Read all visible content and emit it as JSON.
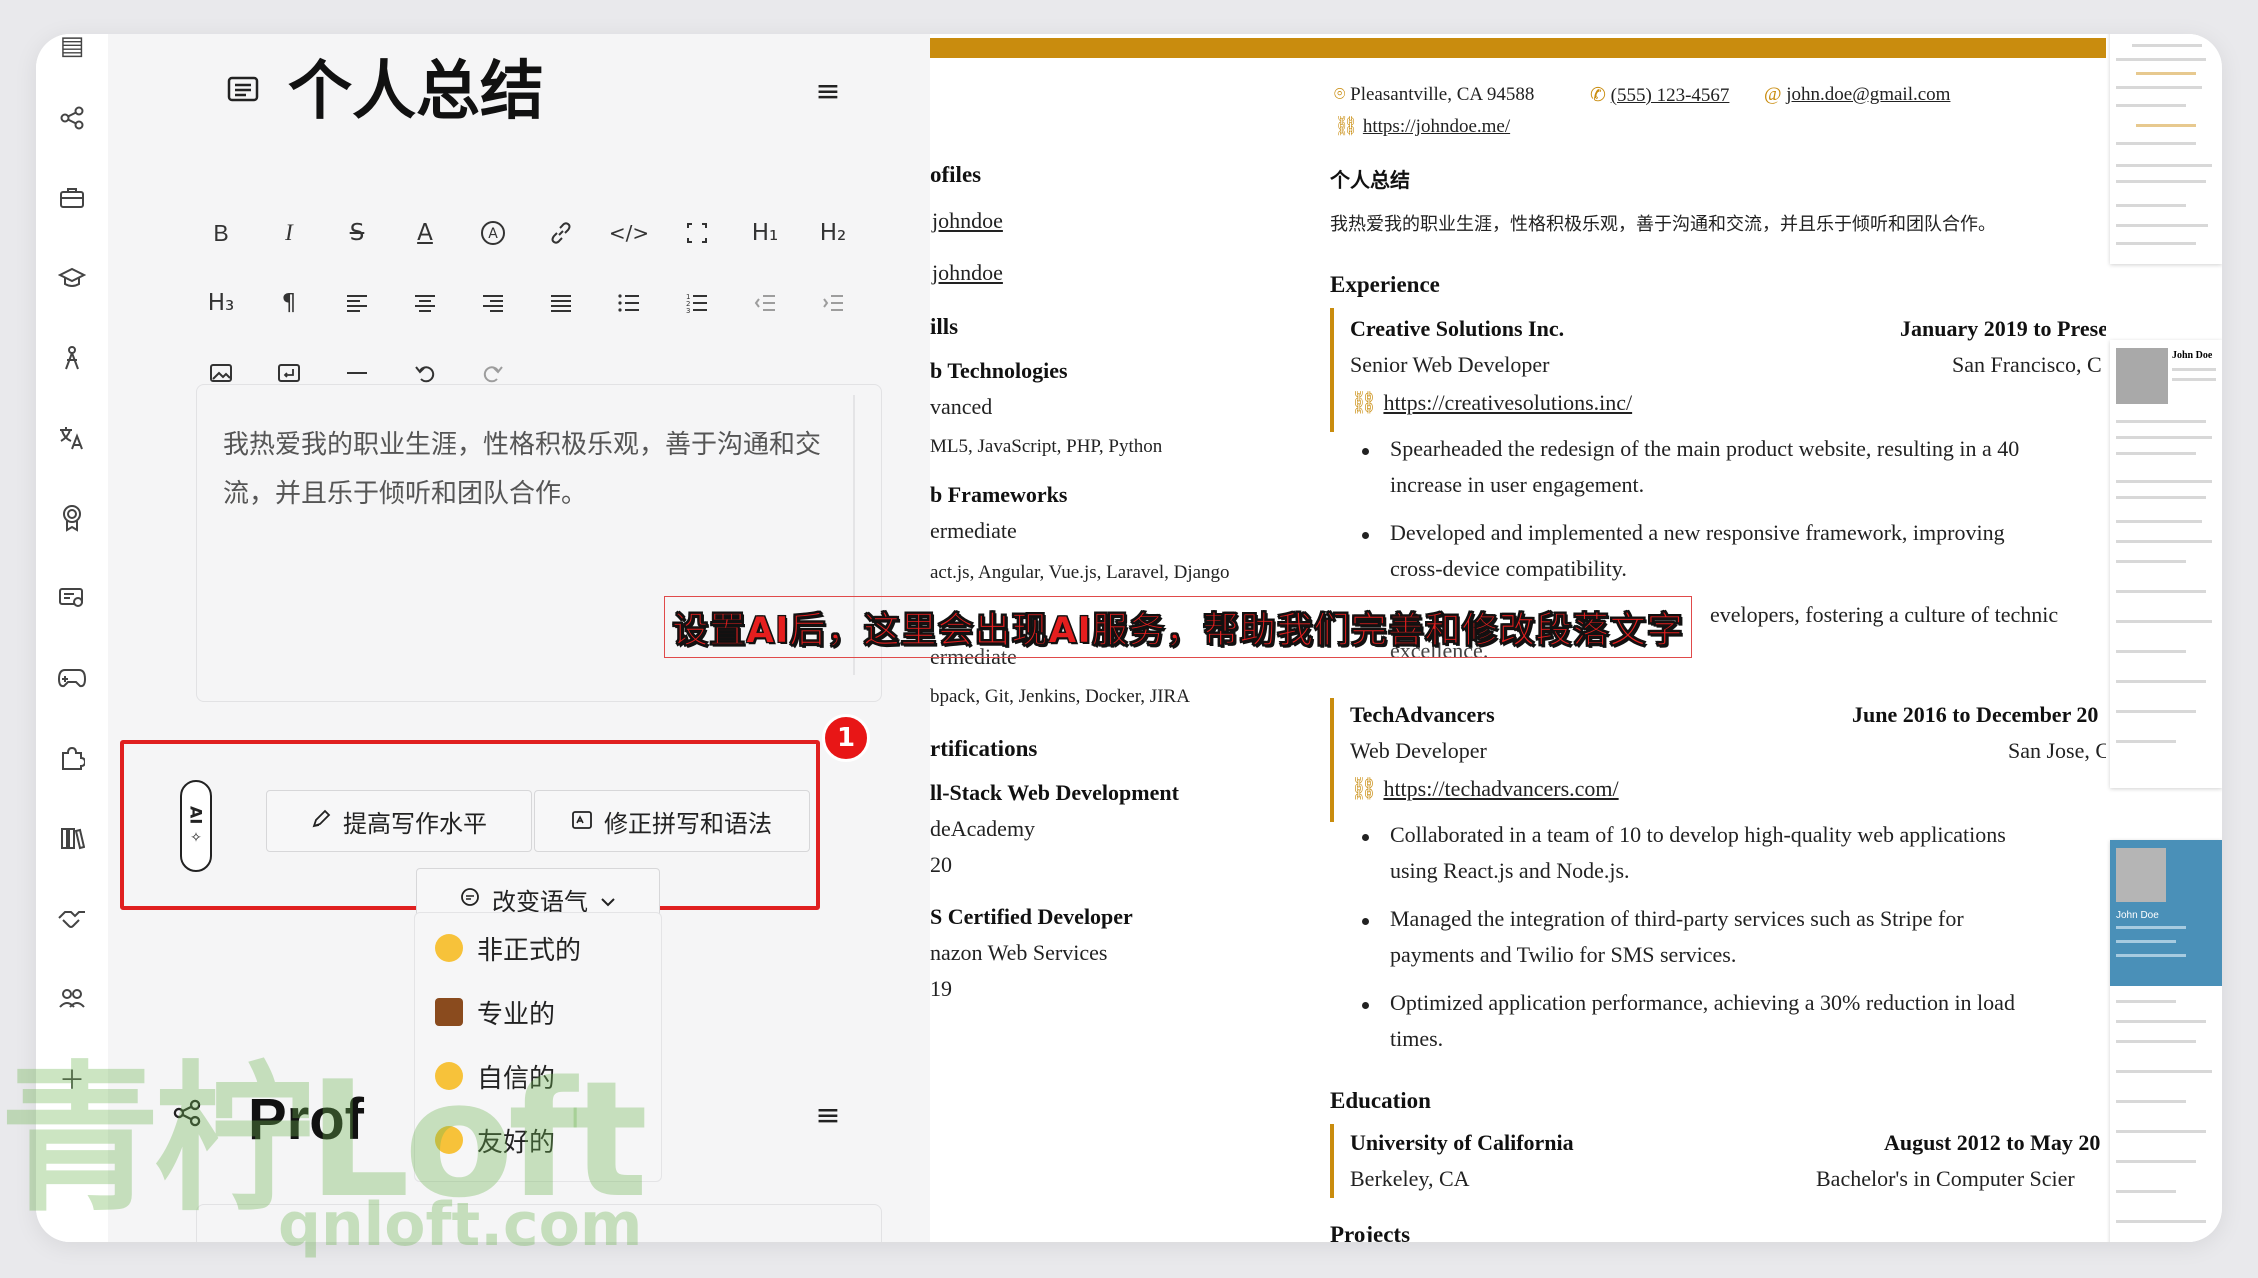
{
  "editor": {
    "summary_title": "个人总结",
    "summary_text": "我热爱我的职业生涯，性格积极乐观，善于沟通和交流，并且乐于倾听和团队合作。",
    "profiles_title": "Prof",
    "toolbar": {
      "bold": "B",
      "italic": "I",
      "strike": "S",
      "color": "A",
      "highlight": "A",
      "h1": "H₁",
      "h2": "H₂",
      "h3": "H₃",
      "paragraph": "¶"
    },
    "ai": {
      "pill_label": "AI",
      "improve_label": "提高写作水平",
      "fix_label": "修正拼写和语法",
      "tone_label": "改变语气",
      "badge": "1",
      "tone_options": [
        "非正式的",
        "专业的",
        "自信的",
        "友好的"
      ]
    }
  },
  "caption": "设置AI后，这里会出现AI服务，帮助我们完善和修改段落文字",
  "watermark": {
    "big": "青柠Loft",
    "small": "qnloft.com"
  },
  "resume": {
    "address": "Pleasantville, CA 94588",
    "phone": "(555) 123-4567",
    "email": "john.doe@gmail.com",
    "website": "https://johndoe.me/",
    "left_column": {
      "profiles_heading": "ofiles",
      "profile_1": "johndoe",
      "profile_2": "johndoe",
      "skills_heading": "ills",
      "web_tech": "b Technologies",
      "web_tech_level": "vanced",
      "web_tech_list": "ML5, JavaScript, PHP, Python",
      "frameworks": "b Frameworks",
      "frameworks_level": "ermediate",
      "frameworks_list": "act.js, Angular, Vue.js, Laravel, Django",
      "tools_level": "ermediate",
      "tools_list": "bpack, Git, Jenkins, Docker, JIRA",
      "certs_heading": "rtifications",
      "cert_1": "ll-Stack Web Development",
      "cert_1_issuer": "deAcademy",
      "cert_1_year": "20",
      "cert_2": "S Certified Developer",
      "cert_2_issuer": "nazon Web Services",
      "cert_2_year": "19"
    },
    "summary_heading": "个人总结",
    "summary_text": "我热爱我的职业生涯，性格积极乐观，善于沟通和交流，并且乐于倾听和团队合作。",
    "experience_heading": "Experience",
    "jobs": [
      {
        "company": "Creative Solutions Inc.",
        "dates": "January 2019 to Prese",
        "title": "Senior Web Developer",
        "location": "San Francisco, C",
        "url": "https://creativesolutions.inc/",
        "bullets": [
          "Spearheaded the redesign of the main product website, resulting in a 40",
          "increase in user engagement.",
          "Developed and implemented a new responsive framework, improving",
          "cross-device compatibility.",
          "evelopers, fostering a culture of technic",
          "excellence."
        ]
      },
      {
        "company": "TechAdvancers",
        "dates": "June 2016 to December 20",
        "title": "Web Developer",
        "location": "San Jose, C",
        "url": "https://techadvancers.com/",
        "bullets": [
          "Collaborated in a team of 10 to develop high-quality web applications",
          "using React.js and Node.js.",
          "Managed the integration of third-party services such as Stripe for",
          "payments and Twilio for SMS services.",
          "Optimized application performance, achieving a 30% reduction in load",
          "times."
        ]
      }
    ],
    "education_heading": "Education",
    "school": "University of California",
    "school_dates": "August 2012 to May 20",
    "school_location": "Berkeley, CA",
    "degree": "Bachelor's in Computer Scier",
    "projects_heading": "Projects"
  },
  "thumbs": {
    "name_1": "John Doe",
    "name_2": "John Doe"
  },
  "colors": {
    "accent": "#c98c0e",
    "highlight": "#e02020",
    "badge": "#e81616"
  }
}
